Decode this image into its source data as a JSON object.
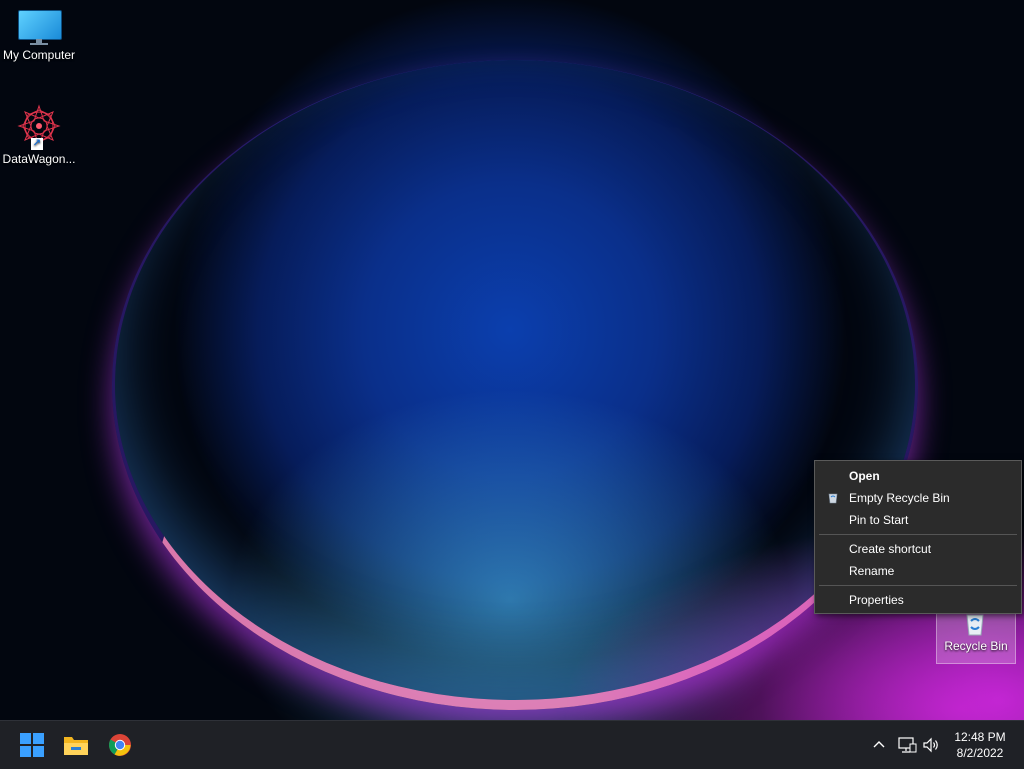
{
  "desktop": {
    "icons": [
      {
        "label": "My Computer",
        "icon": "monitor-icon"
      },
      {
        "label": "DataWagon...",
        "icon": "starburst-app-icon"
      },
      {
        "label": "Recycle Bin",
        "icon": "recycle-bin-icon"
      }
    ]
  },
  "context_menu": {
    "items": [
      {
        "label": "Open",
        "bold": true
      },
      {
        "label": "Empty Recycle Bin",
        "icon": "recycle-bin-icon"
      },
      {
        "label": "Pin to Start"
      },
      {
        "label": "Create shortcut"
      },
      {
        "label": "Rename"
      },
      {
        "label": "Properties"
      }
    ]
  },
  "taskbar": {
    "pinned": [
      {
        "name": "Start",
        "icon": "windows-logo-icon"
      },
      {
        "name": "File Explorer",
        "icon": "folder-icon"
      },
      {
        "name": "Google Chrome",
        "icon": "chrome-icon"
      }
    ],
    "tray": {
      "icons": [
        "chevron-up-icon",
        "network-icon",
        "volume-icon"
      ]
    },
    "clock": {
      "time": "12:48 PM",
      "date": "8/2/2022"
    }
  },
  "colors": {
    "accent": "#3aa0ff",
    "menu_bg": "#2b2b2b",
    "taskbar_bg": "#1f2126"
  }
}
